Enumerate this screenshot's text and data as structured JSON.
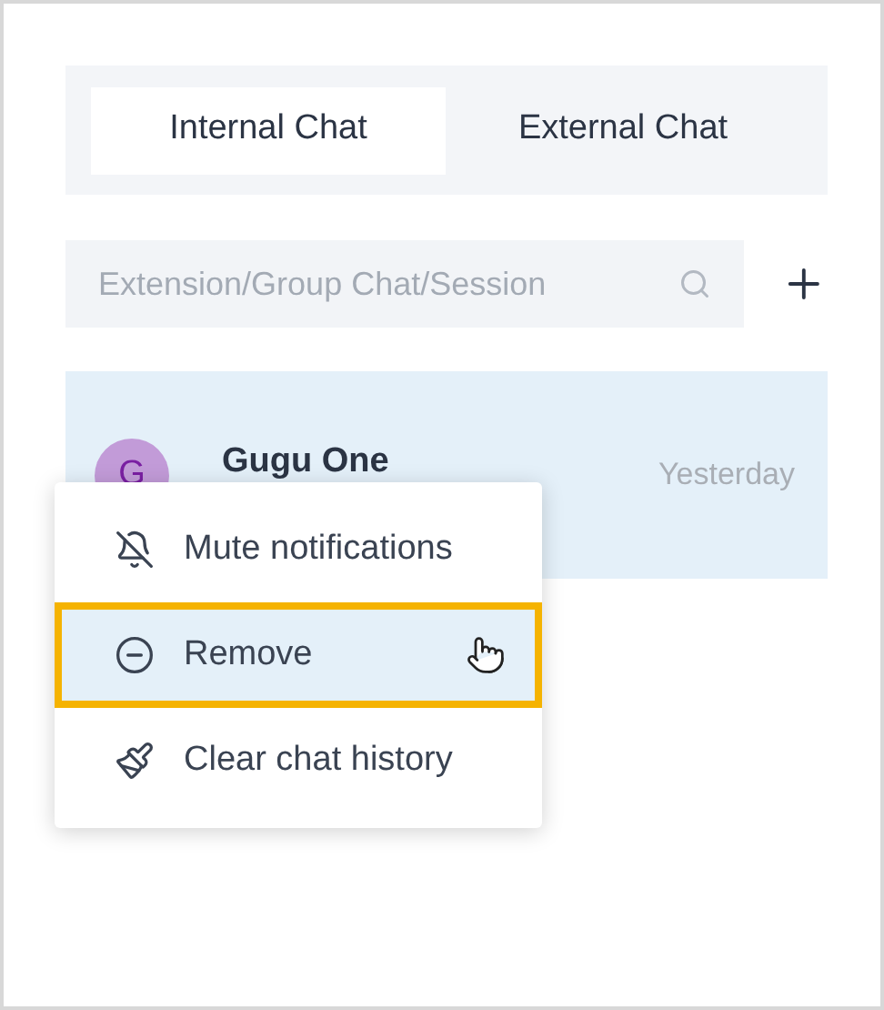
{
  "tabs": [
    {
      "label": "Internal Chat",
      "selected": true
    },
    {
      "label": "External Chat",
      "selected": false
    }
  ],
  "search": {
    "placeholder": "Extension/Group Chat/Session"
  },
  "chats": [
    {
      "initial": "G",
      "name": "Gugu One",
      "time": "Yesterday",
      "selected": true
    }
  ],
  "context_menu": [
    {
      "kind": "mute",
      "label": "Mute notifications",
      "selected": false
    },
    {
      "kind": "remove",
      "label": "Remove",
      "selected": true
    },
    {
      "kind": "clear",
      "label": "Clear chat history",
      "selected": false
    }
  ]
}
